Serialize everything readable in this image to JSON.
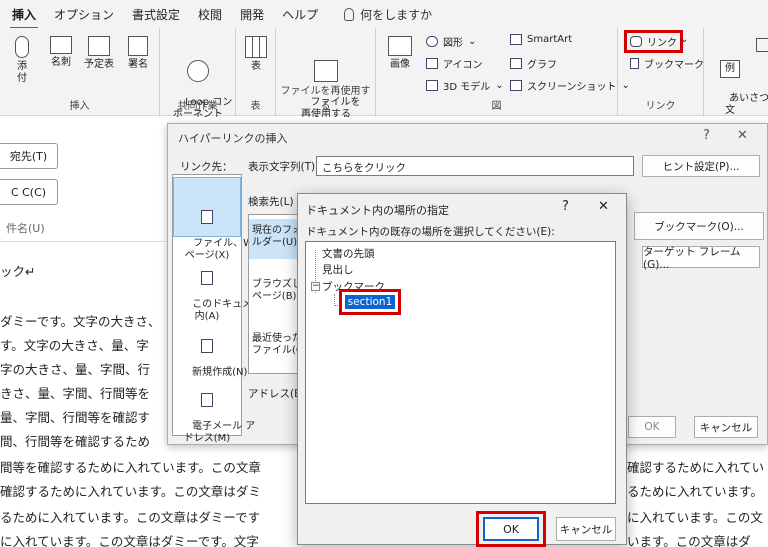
{
  "tabs": {
    "items": [
      "挿入",
      "オプション",
      "書式設定",
      "校閲",
      "開発",
      "ヘルプ"
    ],
    "tell_me": "何をしますか"
  },
  "ribbon": {
    "insert_group": {
      "label": "挿入",
      "buttons": [
        "添\n付",
        "名刺",
        "予定表",
        "署名"
      ]
    },
    "collab_group": {
      "label": "共同作業",
      "loop": "Loop コン\nポーネント"
    },
    "table_group": {
      "label": "表",
      "table": "表"
    },
    "reuse_group": {
      "label": "ファイルを再使用する",
      "reuse": "ファイルを\n再使用する"
    },
    "illust_group": {
      "label": "図",
      "image": "画像",
      "shapes": "図形",
      "icons": "アイコン",
      "models": "3D モデル",
      "smartart": "SmartArt",
      "graph": "グラフ",
      "screenshot": "スクリーンショット"
    },
    "link_group": {
      "label": "リンク",
      "link": "リンク",
      "bookmark": "ブックマーク"
    },
    "greeting": {
      "label": "あいさつ\n文"
    },
    "sample_icon": "例"
  },
  "compose": {
    "to": "宛先(T)",
    "cc": "C C(C)",
    "subject": "件名(U)",
    "lines": [
      "ック↵",
      "ダミーです。文字の大きさ、",
      "す。文字の大きさ、量、字",
      "字の大きさ、量、字間、行",
      "きさ、量、字間、行間等を",
      "量、字間、行間等を確認す",
      "間、行間等を確認するため",
      "間等を確認するために入れています。この文章",
      "確認するために入れています。この文章はダミ",
      "るために入れています。この文章はダミーです",
      "に入れています。この文章はダミーです。文字"
    ],
    "right_lines": [
      "確認するために入れてい",
      "るために入れています。",
      "に入れています。この文",
      "います。この文章はダ"
    ]
  },
  "dialog": {
    "title": "ハイパーリンクの挿入",
    "help": "?",
    "close": "✕",
    "link_to_label": "リンク先：",
    "display_text_label": "表示文字列(T):",
    "display_text_value": "こちらをクリック",
    "hint_button": "ヒント設定(P)...",
    "search_label": "検索先(L)",
    "bookmark_button": "ブックマーク(O)...",
    "target_frame_button": "ターゲット フレーム(G)...",
    "sidebar": [
      "ファイル、Web\nページ(X)",
      "このドキュメント\n内(A)",
      "新規作成(N)",
      "電子メール ア\nドレス(M)"
    ],
    "list_items": [
      "現在のフォ\nルダー(U)",
      "ブラウズした\nページ(B)",
      "最近使った\nファイル(C)"
    ],
    "address_label": "アドレス(E):",
    "ok": "OK",
    "cancel": "キャンセル"
  },
  "subdialog": {
    "title": "ドキュメント内の場所の指定",
    "help": "?",
    "close": "✕",
    "prompt": "ドキュメント内の既存の場所を選択してください(E):",
    "tree": [
      "文書の先頭",
      "見出し",
      "ブックマーク"
    ],
    "selected": "section1",
    "ok": "OK",
    "cancel": "キャンセル"
  },
  "colors": {
    "accent": "#0a64d2",
    "highlight": "#d40000",
    "tab_underline": "#c0392b"
  }
}
